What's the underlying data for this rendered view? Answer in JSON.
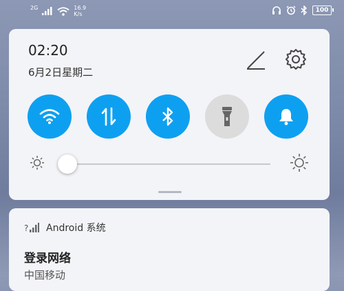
{
  "status_bar": {
    "network_label": "2G",
    "speed_value": "16.9",
    "speed_unit": "K/s",
    "battery": "100"
  },
  "quick_settings": {
    "time": "02:20",
    "date": "6月2日星期二",
    "tiles": [
      {
        "icon": "wifi-icon",
        "state": "on"
      },
      {
        "icon": "mobile-data-icon",
        "state": "on"
      },
      {
        "icon": "bluetooth-icon",
        "state": "on"
      },
      {
        "icon": "flashlight-icon",
        "state": "off"
      },
      {
        "icon": "bell-icon",
        "state": "on"
      }
    ],
    "brightness_level": 0.0
  },
  "notification": {
    "app_name": "Android 系统",
    "title": "登录网络",
    "subtitle": "中国移动"
  },
  "colors": {
    "accent": "#0ea0f0",
    "tile_off": "#dcdcdc",
    "panel_bg": "#f3f4f8"
  }
}
